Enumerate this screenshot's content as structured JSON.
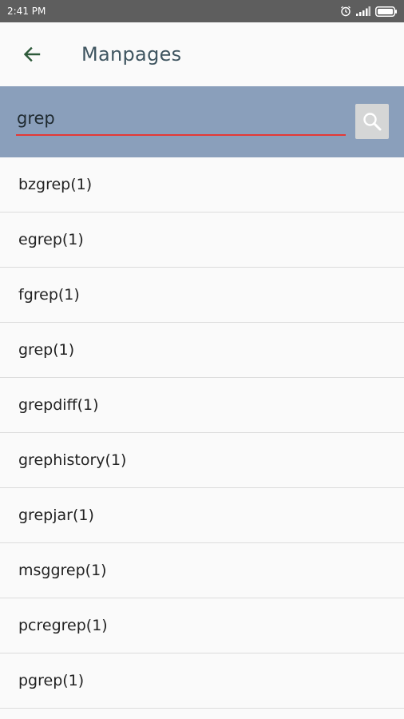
{
  "status_bar": {
    "time": "2:41 PM",
    "icons": [
      "alarm-icon",
      "signal-icon",
      "battery-icon"
    ]
  },
  "app_bar": {
    "back_icon": "arrow-left-icon",
    "title": "Manpages"
  },
  "search": {
    "value": "grep",
    "placeholder": "",
    "button_icon": "search-icon",
    "underline_color": "#e53935"
  },
  "results": [
    "bzgrep(1)",
    "egrep(1)",
    "fgrep(1)",
    "grep(1)",
    "grepdiff(1)",
    "grephistory(1)",
    "grepjar(1)",
    "msggrep(1)",
    "pcregrep(1)",
    "pgrep(1)"
  ],
  "colors": {
    "status_bar": "#5e5e5e",
    "search_panel": "#8a9fbb",
    "title": "#3f5560",
    "back_arrow": "#2e5a3a"
  }
}
